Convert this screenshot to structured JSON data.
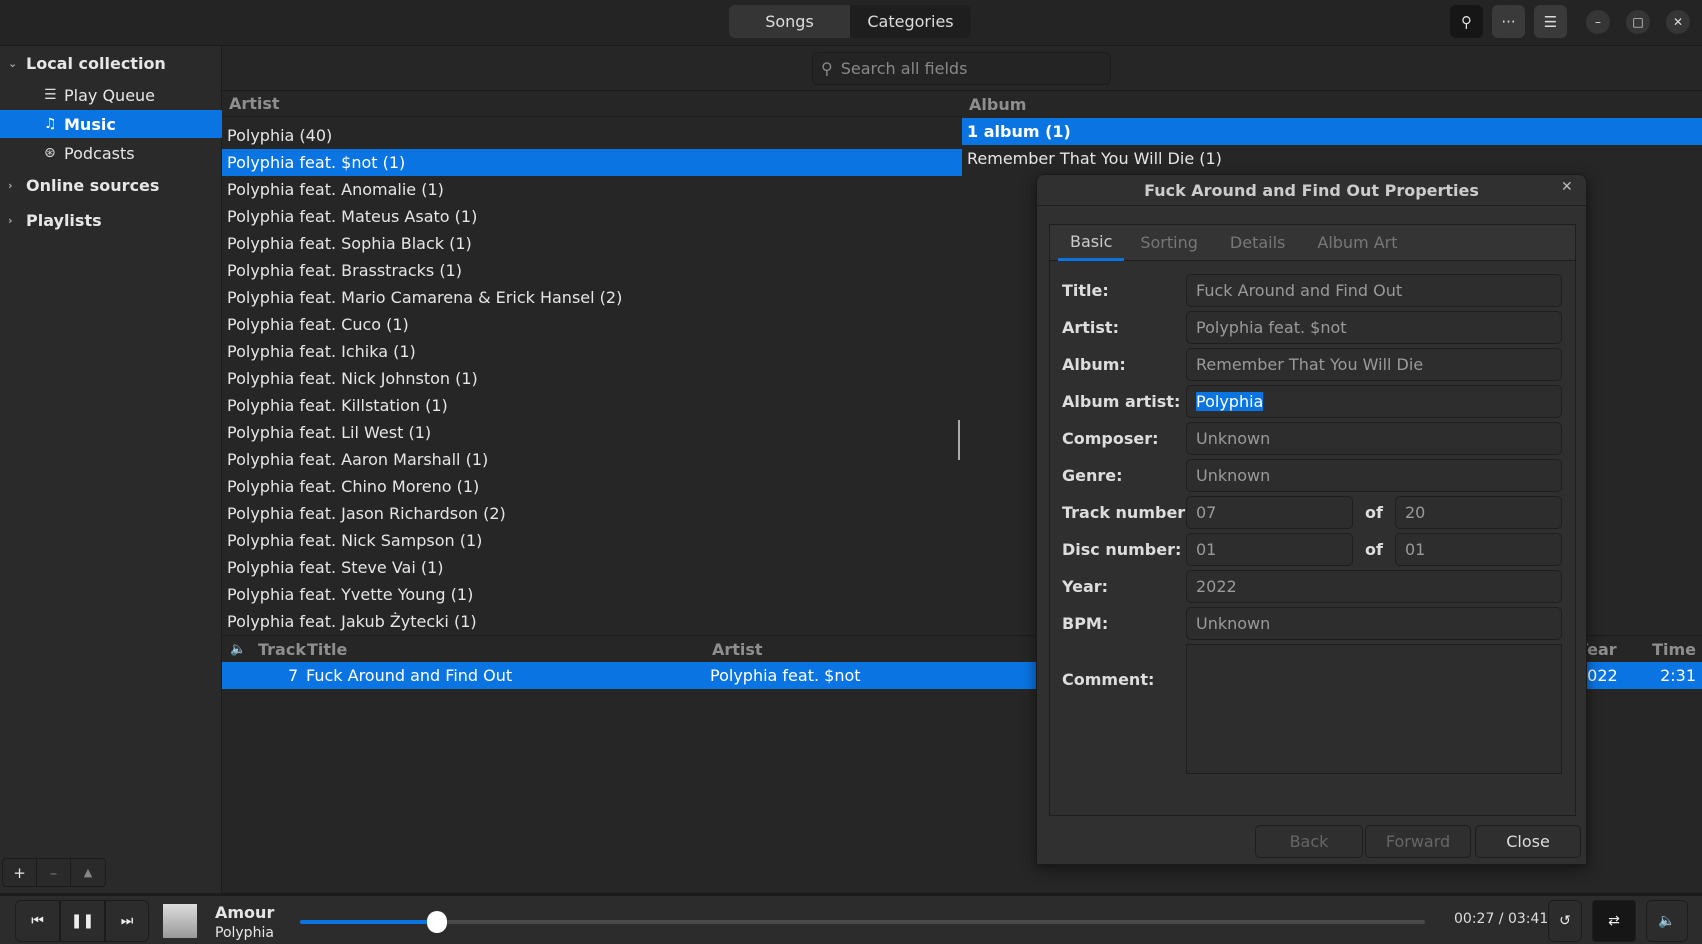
{
  "header": {
    "tabs": [
      {
        "label": "Songs",
        "active": false
      },
      {
        "label": "Categories",
        "active": true
      }
    ],
    "buttons": [
      "search-icon",
      "more-icon",
      "menu-icon"
    ],
    "window": [
      "minimize-icon",
      "maximize-icon",
      "close-icon"
    ]
  },
  "sidebar": {
    "groups": [
      {
        "label": "Local collection",
        "expanded": true
      },
      {
        "label": "Online sources",
        "expanded": false
      },
      {
        "label": "Playlists",
        "expanded": false
      }
    ],
    "items": [
      {
        "label": "Play Queue",
        "icon": "list-icon"
      },
      {
        "label": "Music",
        "icon": "music-note-icon",
        "selected": true
      },
      {
        "label": "Podcasts",
        "icon": "rss-icon"
      }
    ],
    "footer": [
      "+",
      "–",
      "▲"
    ]
  },
  "search": {
    "placeholder": "Search all fields",
    "value": ""
  },
  "artist_pane": {
    "header": "Artist",
    "rows": [
      "Polyphia (40)",
      "Polyphia feat. $not (1)",
      "Polyphia feat. Anomalie (1)",
      "Polyphia feat. Mateus Asato (1)",
      "Polyphia feat. Sophia Black (1)",
      "Polyphia feat. Brasstracks (1)",
      "Polyphia feat. Mario Camarena & Erick Hansel (2)",
      "Polyphia feat. Cuco (1)",
      "Polyphia feat. Ichika (1)",
      "Polyphia feat. Nick Johnston (1)",
      "Polyphia feat. Killstation (1)",
      "Polyphia feat. Lil West (1)",
      "Polyphia feat. Aaron Marshall (1)",
      "Polyphia feat. Chino Moreno (1)",
      "Polyphia feat. Jason Richardson (2)",
      "Polyphia feat. Nick Sampson (1)",
      "Polyphia feat. Steve Vai (1)",
      "Polyphia feat. Yvette Young (1)",
      "Polyphia feat. Jakub Żytecki (1)"
    ],
    "selected_index": 1
  },
  "album_pane": {
    "header": "Album",
    "rows": [
      "1 album (1)",
      "Remember That You Will Die (1)"
    ],
    "selected_index": 0
  },
  "tracks": {
    "columns": {
      "track": "Track",
      "title": "Title",
      "artist": "Artist",
      "year": "Year",
      "time": "Time"
    },
    "rows": [
      {
        "track": "7",
        "title": "Fuck Around and Find Out",
        "artist": "Polyphia feat. $not",
        "year": "2022",
        "time": "2:31"
      }
    ]
  },
  "dialog": {
    "title": "Fuck Around and Find Out Properties",
    "tabs": [
      "Basic",
      "Sorting",
      "Details",
      "Album Art"
    ],
    "active_tab": "Basic",
    "fields": {
      "title_label": "Title:",
      "title": "Fuck Around and Find Out",
      "artist_label": "Artist:",
      "artist": "Polyphia feat. $not",
      "album_label": "Album:",
      "album": "Remember That You Will Die",
      "album_artist_label": "Album artist:",
      "album_artist": "Polyphia",
      "composer_label": "Composer:",
      "composer": "Unknown",
      "genre_label": "Genre:",
      "genre": "Unknown",
      "track_label": "Track number:",
      "track": "07",
      "track_total": "20",
      "disc_label": "Disc number:",
      "disc": "01",
      "disc_total": "01",
      "of": "of",
      "year_label": "Year:",
      "year": "2022",
      "bpm_label": "BPM:",
      "bpm": "Unknown",
      "comment_label": "Comment:",
      "comment": ""
    },
    "buttons": {
      "back": "Back",
      "forward": "Forward",
      "close": "Close"
    }
  },
  "player": {
    "title": "Amour",
    "artist": "Polyphia",
    "elapsed": "00:27",
    "total": "03:41",
    "time_text": "00:27 / 03:41",
    "progress": 0.122,
    "shuffle": true
  },
  "colors": {
    "accent": "#0a74e3"
  }
}
